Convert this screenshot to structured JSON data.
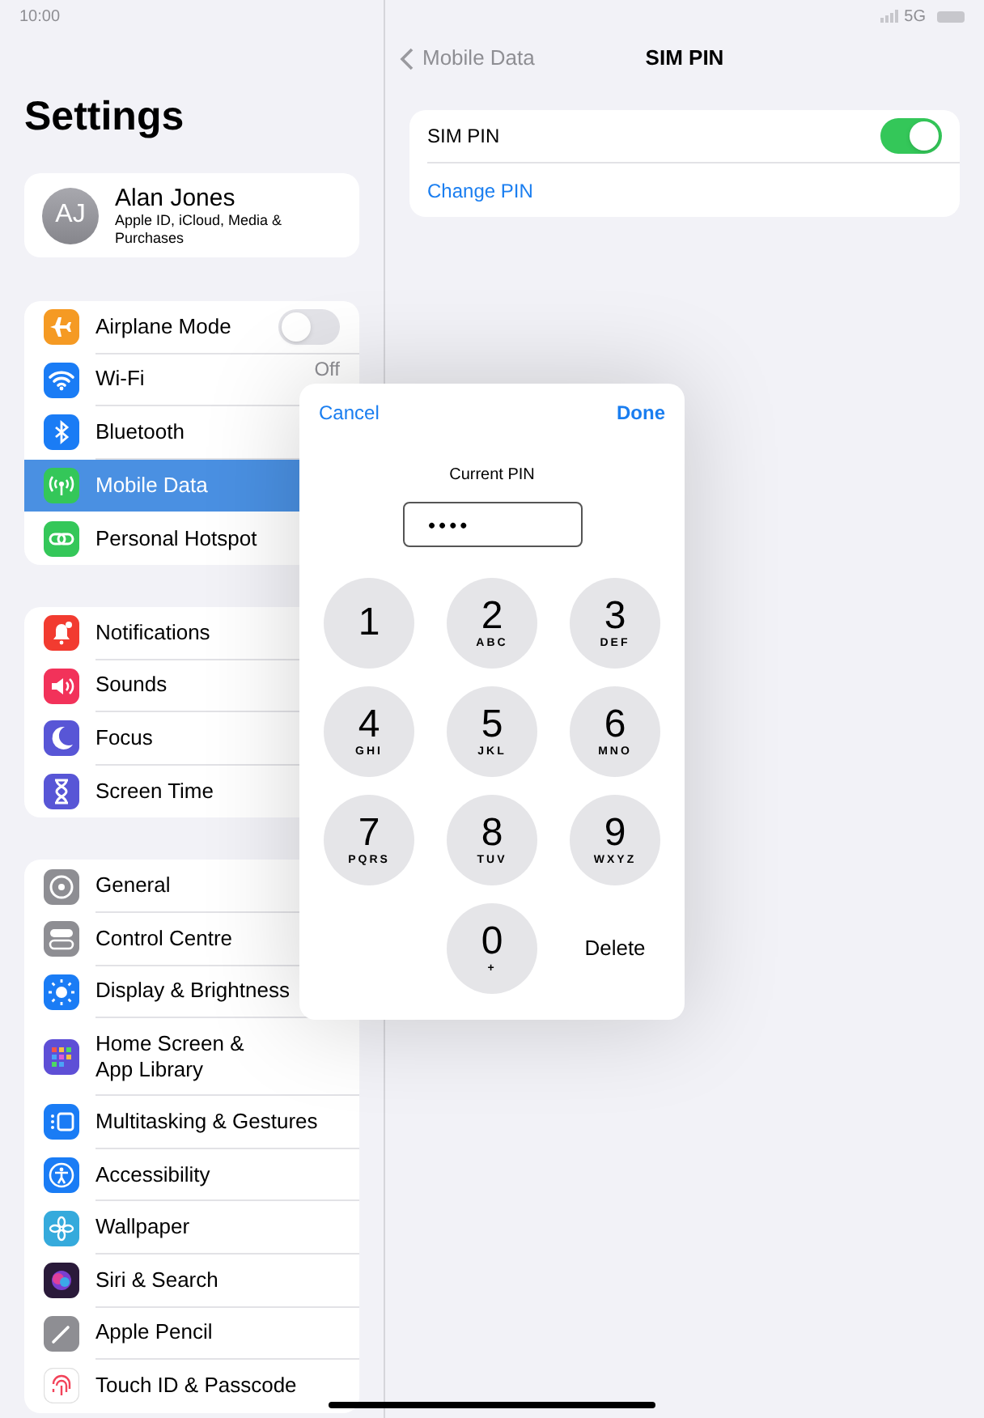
{
  "status_bar": {
    "time": "10:00",
    "network": "5G"
  },
  "sidebar": {
    "title": "Settings",
    "profile": {
      "initials": "AJ",
      "name": "Alan Jones",
      "subtitle": "Apple ID, iCloud, Media & Purchases"
    },
    "groups": [
      [
        {
          "label": "Airplane Mode",
          "color": "#f59a23",
          "kind": "toggle",
          "on": false,
          "selected": false
        },
        {
          "label": "Wi-Fi",
          "color": "#1a7cf5",
          "kind": "value",
          "value": "Off",
          "selected": false
        },
        {
          "label": "Bluetooth",
          "color": "#1a7cf5",
          "kind": "plain",
          "selected": false
        },
        {
          "label": "Mobile Data",
          "color": "#34c759",
          "kind": "plain",
          "selected": true
        },
        {
          "label": "Personal Hotspot",
          "color": "#34c759",
          "kind": "plain",
          "selected": false
        }
      ],
      [
        {
          "label": "Notifications",
          "color": "#f23b30",
          "kind": "plain",
          "selected": false
        },
        {
          "label": "Sounds",
          "color": "#f2325a",
          "kind": "plain",
          "selected": false
        },
        {
          "label": "Focus",
          "color": "#5856d6",
          "kind": "plain",
          "selected": false
        },
        {
          "label": "Screen Time",
          "color": "#5856d6",
          "kind": "plain",
          "selected": false
        }
      ],
      [
        {
          "label": "General",
          "color": "#8e8e93",
          "kind": "plain",
          "selected": false
        },
        {
          "label": "Control Centre",
          "color": "#8e8e93",
          "kind": "plain",
          "selected": false
        },
        {
          "label": "Display & Brightness",
          "color": "#1a7cf5",
          "kind": "plain",
          "selected": false
        },
        {
          "label": "Home Screen & App Library",
          "color": "#5e4fd6",
          "kind": "plain",
          "selected": false
        },
        {
          "label": "Multitasking & Gestures",
          "color": "#1a7cf5",
          "kind": "plain",
          "selected": false
        },
        {
          "label": "Accessibility",
          "color": "#1a7cf5",
          "kind": "plain",
          "selected": false
        },
        {
          "label": "Wallpaper",
          "color": "#35aadc",
          "kind": "plain",
          "selected": false
        },
        {
          "label": "Siri & Search",
          "color": "#2a1a3a",
          "kind": "plain",
          "selected": false
        },
        {
          "label": "Apple Pencil",
          "color": "#8e8e93",
          "kind": "plain",
          "selected": false
        },
        {
          "label": "Touch ID & Passcode",
          "color": "#f2435a",
          "kind": "plain",
          "selected": false
        }
      ]
    ]
  },
  "detail": {
    "back": "Mobile Data",
    "title": "SIM PIN",
    "rows": [
      {
        "label": "SIM PIN",
        "kind": "toggle",
        "on": true
      },
      {
        "label": "Change PIN",
        "kind": "link"
      }
    ]
  },
  "pin_dialog": {
    "cancel": "Cancel",
    "done": "Done",
    "prompt": "Current PIN",
    "value": "••••",
    "keys": [
      {
        "kind": "digit",
        "digit": "1"
      },
      {
        "kind": "digit",
        "digit": "2",
        "letters": "ABC"
      },
      {
        "kind": "digit",
        "digit": "3",
        "letters": "DEF"
      },
      {
        "kind": "digit",
        "digit": "4",
        "letters": "GHI"
      },
      {
        "kind": "digit",
        "digit": "5",
        "letters": "JKL"
      },
      {
        "kind": "digit",
        "digit": "6",
        "letters": "MNO"
      },
      {
        "kind": "digit",
        "digit": "7",
        "letters": "PQRS"
      },
      {
        "kind": "digit",
        "digit": "8",
        "letters": "TUV"
      },
      {
        "kind": "digit",
        "digit": "9",
        "letters": "WXYZ"
      },
      {
        "kind": "blank"
      },
      {
        "kind": "digit",
        "digit": "0",
        "letters": "+"
      },
      {
        "kind": "delete",
        "label": "Delete"
      }
    ]
  }
}
